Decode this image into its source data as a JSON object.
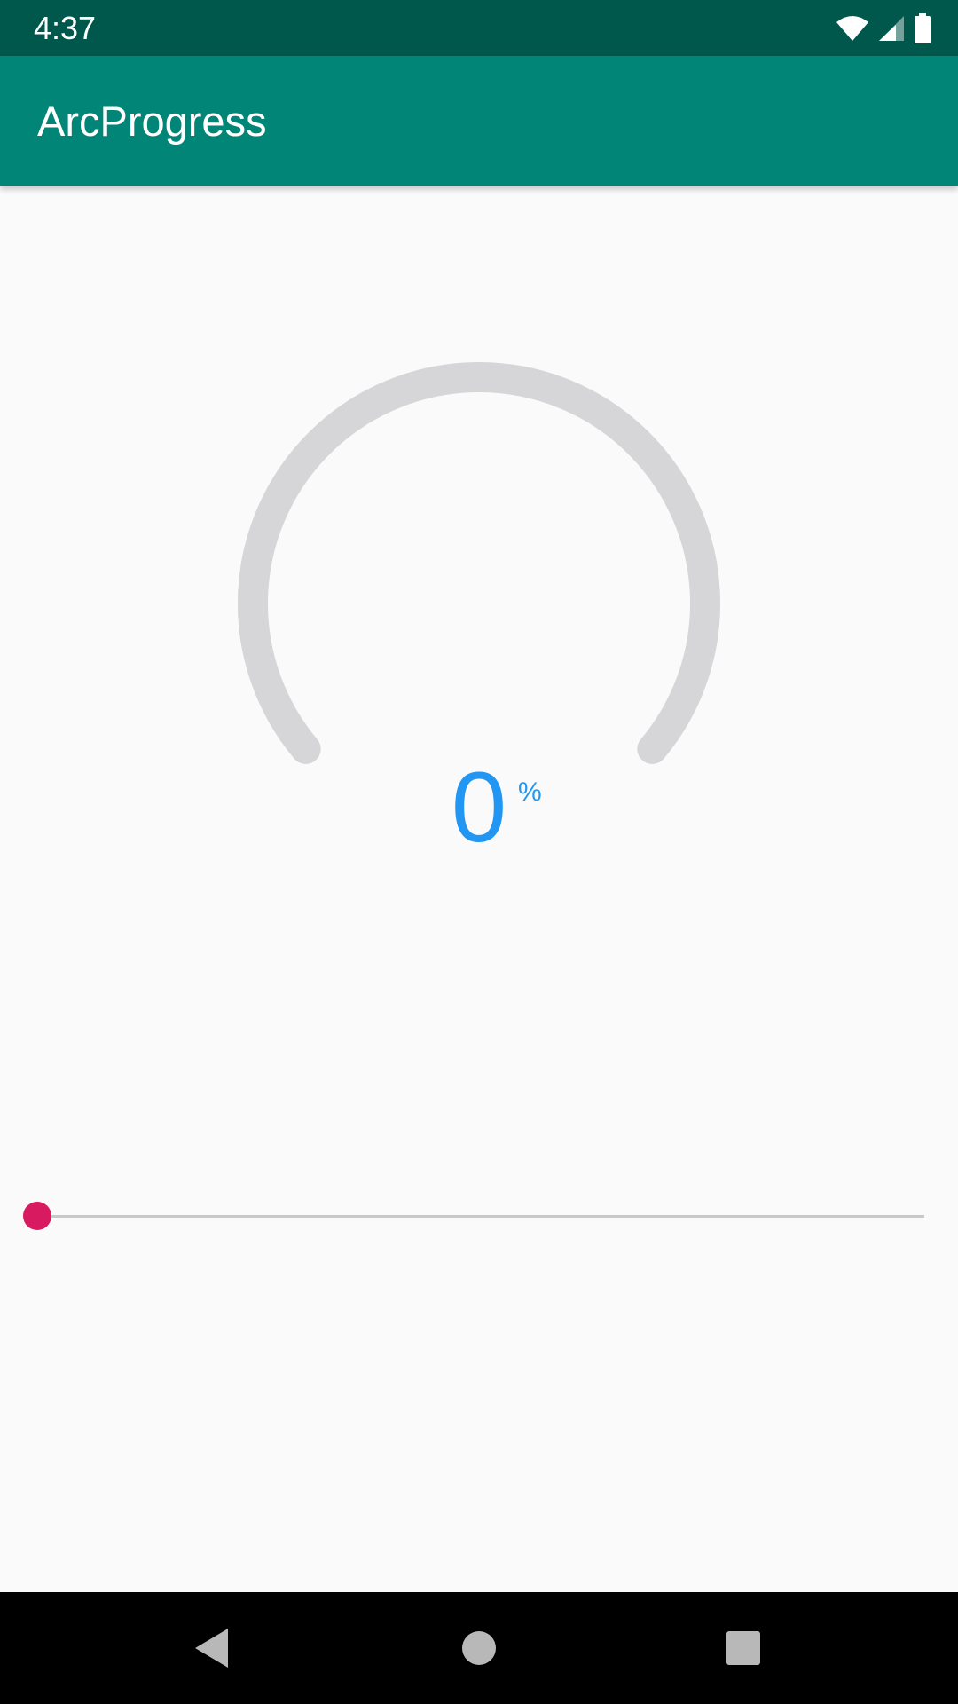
{
  "status_bar": {
    "time": "4:37",
    "icons": [
      "wifi-icon",
      "signal-icon",
      "battery-icon"
    ],
    "background_color": "#00574b"
  },
  "app_bar": {
    "title": "ArcProgress",
    "background_color": "#008577"
  },
  "arc_progress": {
    "value": "0",
    "suffix": "%",
    "progress_fraction": 0.0,
    "track_color": "#d6d6d9",
    "text_color": "#2196f3"
  },
  "seekbar": {
    "progress_fraction": 0.0,
    "accent_color": "#d81b60"
  },
  "nav_bar": {
    "buttons": [
      "back-icon",
      "home-icon",
      "recents-icon"
    ]
  }
}
